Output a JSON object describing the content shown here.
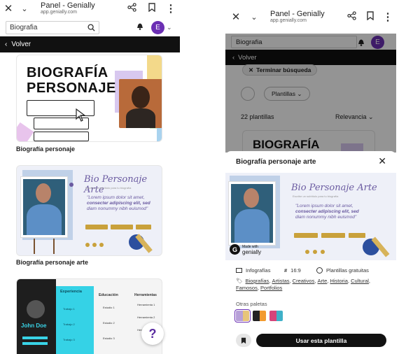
{
  "left": {
    "browser_title": "Panel - Genially",
    "browser_url": "app.genially.com",
    "search_value": "Biografia",
    "avatar_letter": "E",
    "back_label": "Volver",
    "cards": [
      {
        "caption": "Biografía personaje",
        "thumb_title_line1": "BIOGRAFÍA",
        "thumb_title_line2": "PERSONAJE"
      },
      {
        "caption": "Biografía personaje arte",
        "thumb_title": "Bio Personaje Arte",
        "thumb_subtitle": "Escribe un subtítulo para tu biografía",
        "thumb_text_line1": "\"Lorem ipsum dolor sit amet,",
        "thumb_text_line2": "consecter adipiscing elit, sed",
        "thumb_text_line3": "diam nonummy nibh euismod\""
      },
      {
        "name": "John Doe",
        "col1": "Experiencia",
        "col2": "Educación",
        "col3": "Herramientas",
        "items1": [
          "Trabajo 1",
          "Trabajo 2",
          "Trabajo 3"
        ],
        "items2": [
          "Estudio 1",
          "Estudio 2",
          "Estudio 3"
        ],
        "items3": [
          "Herramienta 1",
          "Herramienta 2",
          "Herramienta 3"
        ]
      }
    ],
    "help_label": "?"
  },
  "right": {
    "browser_title": "Panel - Genially",
    "browser_url": "app.genially.com",
    "search_value": "Biografia",
    "avatar_letter": "E",
    "back_label": "Volver",
    "chip_label": "Terminar búsqueda",
    "filter_label": "Plantillas",
    "count_label": "22 plantillas",
    "sort_label": "Relevancia",
    "bg_thumb_title": "BIOGRAFÍA",
    "sheet_title": "Biografía personaje arte",
    "preview_title": "Bio Personaje Arte",
    "preview_subtitle": "Escribe un subtítulo para tu biografía",
    "preview_text_line1": "\"Lorem ipsum dolor sit amet,",
    "preview_text_line2": "consecter adipiscing elit, sed",
    "preview_text_line3": "diam nonummy nibh euismod\"",
    "badge_small": "Made with",
    "badge_label": "genially",
    "meta_type": "Infografías",
    "meta_ratio": "16:9",
    "meta_price": "Plantillas gratuitas",
    "tags": [
      "Biografías",
      "Artistas",
      "Creativos",
      "Arte",
      "Historia",
      "Cultural",
      "Famosos",
      "Portfolios"
    ],
    "palettes_label": "Otras paletas",
    "palettes": [
      [
        "#b7a0d8",
        "#e7c57a"
      ],
      [
        "#222222",
        "#f29a2e"
      ],
      [
        "#d6447a",
        "#3fb0c8"
      ]
    ],
    "use_button": "Usar esta plantilla"
  },
  "colors": {
    "brand_purple": "#6b2fb3",
    "dark": "#111111"
  }
}
